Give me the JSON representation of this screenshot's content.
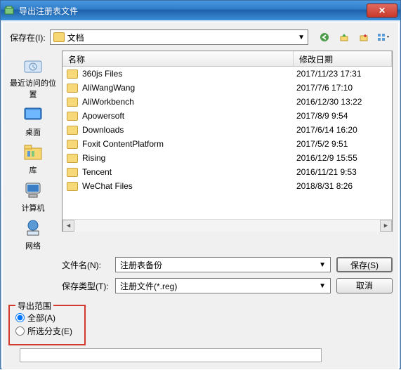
{
  "title": "导出注册表文件",
  "save_in_label": "保存在(I):",
  "location": "文档",
  "nav_icons": [
    "back-icon",
    "up-icon",
    "new-folder-icon",
    "view-icon"
  ],
  "places": [
    {
      "label": "最近访问的位置",
      "icon": "recent"
    },
    {
      "label": "桌面",
      "icon": "desktop"
    },
    {
      "label": "库",
      "icon": "libraries"
    },
    {
      "label": "计算机",
      "icon": "computer"
    },
    {
      "label": "网络",
      "icon": "network"
    }
  ],
  "columns": {
    "name": "名称",
    "date": "修改日期"
  },
  "files": [
    {
      "name": "360js Files",
      "date": "2017/11/23 17:31"
    },
    {
      "name": "AliWangWang",
      "date": "2017/7/6 17:10"
    },
    {
      "name": "AliWorkbench",
      "date": "2016/12/30 13:22"
    },
    {
      "name": "Apowersoft",
      "date": "2017/8/9 9:54"
    },
    {
      "name": "Downloads",
      "date": "2017/6/14 16:20"
    },
    {
      "name": "Foxit ContentPlatform",
      "date": "2017/5/2 9:51"
    },
    {
      "name": "Rising",
      "date": "2016/12/9 15:55"
    },
    {
      "name": "Tencent",
      "date": "2016/11/21 9:53"
    },
    {
      "name": "WeChat Files",
      "date": "2018/8/31 8:26"
    }
  ],
  "filename_label": "文件名(N):",
  "filename_value": "注册表备份",
  "filetype_label": "保存类型(T):",
  "filetype_value": "注册文件(*.reg)",
  "save_btn": "保存(S)",
  "cancel_btn": "取消",
  "export_range": "导出范围",
  "radio_all": "全部(A)",
  "radio_branch": "所选分支(E)"
}
